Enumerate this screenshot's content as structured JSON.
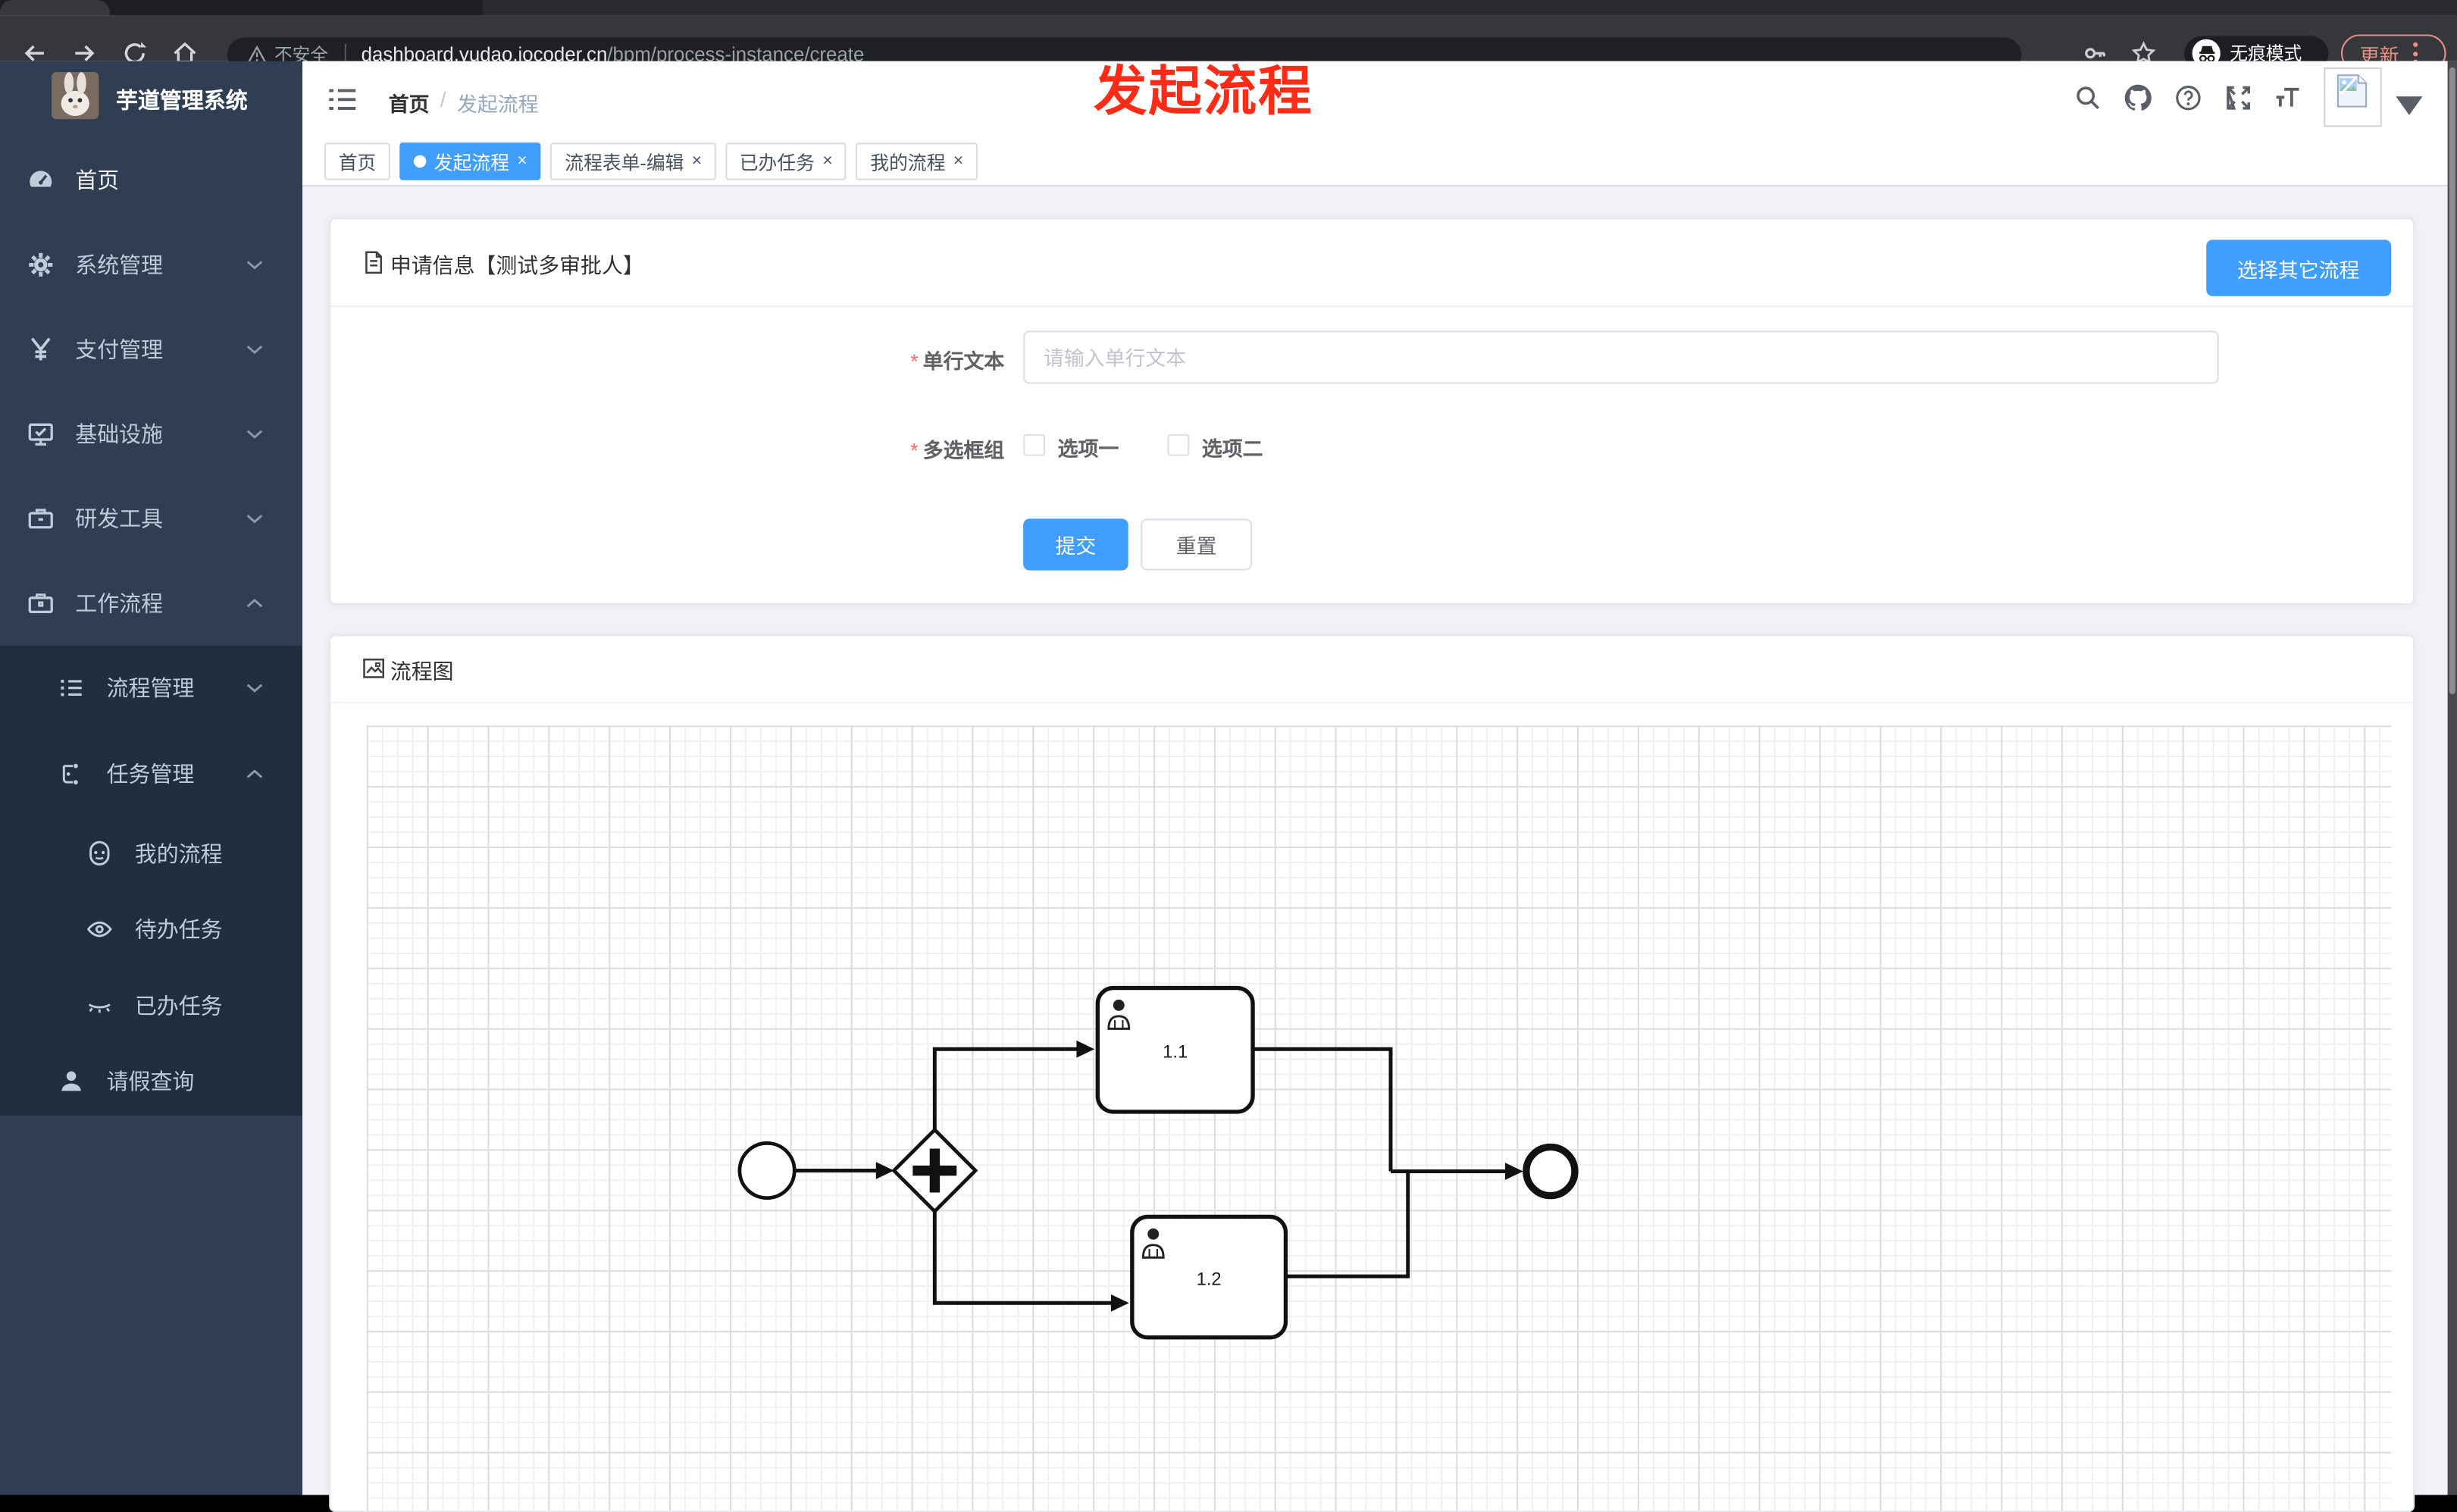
{
  "browser": {
    "secure_label": "不安全",
    "url_host": "dashboard.yudao.iocoder.cn",
    "url_path": "/bpm/process-instance/create",
    "incognito_label": "无痕模式",
    "update_label": "更新"
  },
  "sidebar": {
    "app_title": "芋道管理系统",
    "items": [
      {
        "label": "首页"
      },
      {
        "label": "系统管理"
      },
      {
        "label": "支付管理"
      },
      {
        "label": "基础设施"
      },
      {
        "label": "研发工具"
      },
      {
        "label": "工作流程"
      },
      {
        "label": "流程管理"
      },
      {
        "label": "任务管理"
      },
      {
        "label": "我的流程"
      },
      {
        "label": "待办任务"
      },
      {
        "label": "已办任务"
      },
      {
        "label": "请假查询"
      }
    ]
  },
  "header": {
    "breadcrumb": [
      "首页",
      "发起流程"
    ]
  },
  "tabs": [
    {
      "label": "首页"
    },
    {
      "label": "发起流程"
    },
    {
      "label": "流程表单-编辑"
    },
    {
      "label": "已办任务"
    },
    {
      "label": "我的流程"
    }
  ],
  "ui": {
    "breadcrumb_separator": "/",
    "close_glyph": "×"
  },
  "annotation": {
    "text": "发起流程"
  },
  "form_card": {
    "title": "申请信息【测试多审批人】",
    "choose_button_label": "选择其它流程",
    "text_field": {
      "label": "单行文本",
      "placeholder": "请输入单行文本",
      "required": true,
      "value": ""
    },
    "checkbox_field": {
      "label": "多选框组",
      "required": true,
      "options": [
        {
          "label": "选项一",
          "checked": false
        },
        {
          "label": "选项二",
          "checked": false
        }
      ]
    },
    "submit_label": "提交",
    "reset_label": "重置"
  },
  "diagram_card": {
    "title": "流程图",
    "tasks": [
      {
        "label": "1.1"
      },
      {
        "label": "1.2"
      }
    ]
  },
  "colors": {
    "accent_blue": "#409eff",
    "annotation_red": "#fe2c17",
    "sidebar_bg": "#2f3e52",
    "sidebar_submenu_bg": "#222e40",
    "sidebar_text": "#bfcbd9",
    "update_pill": "#f08c82",
    "content_bg": "#f0f2f5"
  }
}
